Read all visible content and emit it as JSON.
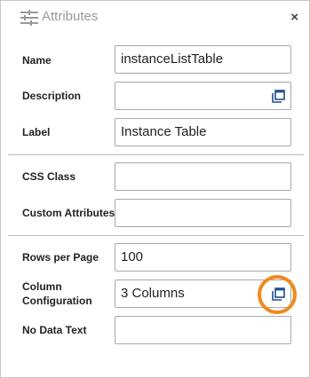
{
  "panel": {
    "title": "Attributes",
    "close_label": "×"
  },
  "fields": {
    "name": {
      "label": "Name",
      "value": "instanceListTable"
    },
    "description": {
      "label": "Description",
      "value": ""
    },
    "label": {
      "label": "Label",
      "value": "Instance Table"
    },
    "css_class": {
      "label": "CSS Class",
      "value": ""
    },
    "custom_attributes": {
      "label": "Custom Attributes",
      "value": ""
    },
    "rows_per_page": {
      "label": "Rows per Page",
      "value": "100"
    },
    "column_configuration": {
      "label_line1": "Column",
      "label_line2": "Configuration",
      "value": "3 Columns"
    },
    "no_data_text": {
      "label": "No Data Text",
      "value": ""
    }
  },
  "icons": {
    "title": "tune-sliders-icon",
    "field_popup": "open-in-window-icon"
  },
  "colors": {
    "highlight": "#f08a1c",
    "icon_accent": "#1f4e8c"
  }
}
